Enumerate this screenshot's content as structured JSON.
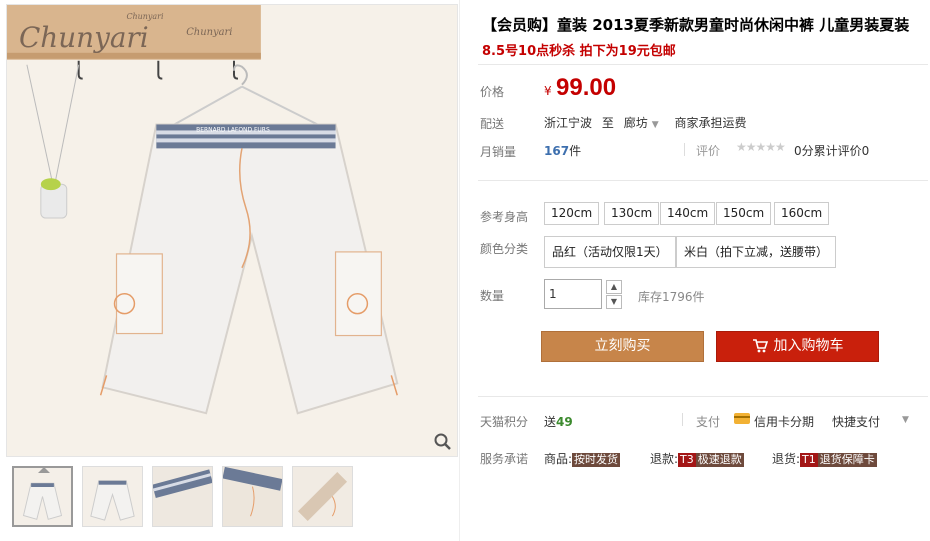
{
  "product": {
    "title": "【会员购】童装 2013夏季新款男童时尚休闲中裤 儿童男装夏装",
    "subtitle": "8.5号10点秒杀 拍下为19元包邮",
    "price_label": "价格",
    "currency": "¥",
    "price": "99.00",
    "shipping_label": "配送",
    "ship_from": "浙江宁波",
    "ship_to_word": "至",
    "ship_to": "廊坊",
    "shipping_fee": "商家承担运费",
    "sales_label": "月销量",
    "sales_count": "167",
    "sales_unit": "件",
    "review_label": "评价",
    "stars": "★★★★★",
    "review_score": "0分",
    "review_count": "累计评价0"
  },
  "options": {
    "height_label": "参考身高",
    "heights": [
      "120cm",
      "130cm",
      "140cm",
      "150cm",
      "160cm"
    ],
    "color_label": "颜色分类",
    "colors": [
      "品红（活动仅限1天）",
      "米白（拍下立减，送腰带）"
    ],
    "qty_label": "数量",
    "qty_value": "1",
    "stock": "库存1796件"
  },
  "actions": {
    "buy_now": "立刻购买",
    "add_to_cart": "加入购物车"
  },
  "extras": {
    "points_label": "天猫积分",
    "points_prefix": "送",
    "points_value": "49",
    "pay_label": "支付",
    "installments": "信用卡分期",
    "quickpay": "快捷支付",
    "service_label": "服务承诺",
    "svc1_prefix": "商品:",
    "svc1_tag": "按时发货",
    "svc2_prefix": "退款:",
    "svc2_code": "T3",
    "svc2_tag": "极速退款",
    "svc3_prefix": "退货:",
    "svc3_code": "T1",
    "svc3_tag": "退货保障卡"
  },
  "gallery": {
    "brand_logo_text": "Chunyari",
    "belt_text": "BERNARD LAFOND FURS",
    "thumbnail_count": 5,
    "active_thumbnail": 1
  },
  "icons": {
    "zoom": "magnifier-icon",
    "cart": "cart-icon",
    "card": "credit-card-icon"
  }
}
